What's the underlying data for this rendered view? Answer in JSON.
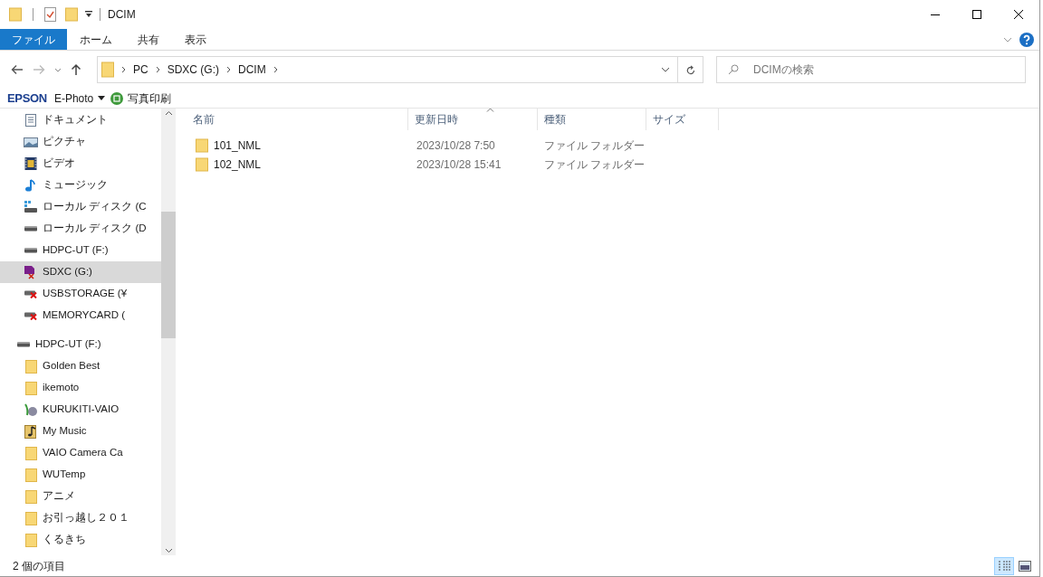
{
  "window": {
    "title": "DCIM"
  },
  "ribbon_tabs": [
    {
      "label": "ファイル",
      "selected": true
    },
    {
      "label": "ホーム",
      "selected": false
    },
    {
      "label": "共有",
      "selected": false
    },
    {
      "label": "表示",
      "selected": false
    }
  ],
  "address": {
    "path": [
      "PC",
      "SDXC (G:)",
      "DCIM"
    ]
  },
  "search": {
    "placeholder": "DCIMの検索"
  },
  "toolbar": {
    "brand": "EPSON",
    "app": "E-Photo",
    "print": "写真印刷"
  },
  "sidebar": {
    "pc_items": [
      {
        "label": "ドキュメント",
        "kind": "document",
        "selected": false
      },
      {
        "label": "ピクチャ",
        "kind": "picture",
        "selected": false
      },
      {
        "label": "ビデオ",
        "kind": "video",
        "selected": false
      },
      {
        "label": "ミュージック",
        "kind": "music",
        "selected": false
      },
      {
        "label": "ローカル ディスク (C",
        "kind": "osdrive",
        "selected": false
      },
      {
        "label": "ローカル ディスク (D",
        "kind": "drive",
        "selected": false
      },
      {
        "label": "HDPC-UT (F:)",
        "kind": "drive",
        "selected": false
      },
      {
        "label": "SDXC (G:)",
        "kind": "card",
        "selected": true
      },
      {
        "label": "USBSTORAGE (¥",
        "kind": "removable",
        "selected": false
      },
      {
        "label": "MEMORYCARD (",
        "kind": "removable",
        "selected": false
      }
    ],
    "tree": [
      {
        "label": "HDPC-UT (F:)",
        "kind": "drive",
        "selected": false,
        "children": [
          {
            "label": "Golden Best",
            "kind": "folder",
            "selected": false
          },
          {
            "label": "ikemoto",
            "kind": "folder",
            "selected": false
          },
          {
            "label": "KURUKITI-VAIO",
            "kind": "network",
            "selected": false
          },
          {
            "label": "My Music",
            "kind": "musicfolder",
            "selected": false
          },
          {
            "label": "VAIO Camera Ca",
            "kind": "folder",
            "selected": false
          },
          {
            "label": "WUTemp",
            "kind": "folder",
            "selected": false
          },
          {
            "label": "アニメ",
            "kind": "folder",
            "selected": false
          },
          {
            "label": "お引っ越し２０１",
            "kind": "folder",
            "selected": false
          },
          {
            "label": "くるきち",
            "kind": "folder",
            "selected": false
          }
        ]
      }
    ]
  },
  "table": {
    "columns": [
      "名前",
      "更新日時",
      "種類",
      "サイズ"
    ],
    "rows": [
      {
        "name": "101_NML",
        "modified": "2023/10/28 7:50",
        "type": "ファイル フォルダー"
      },
      {
        "name": "102_NML",
        "modified": "2023/10/28 15:41",
        "type": "ファイル フォルダー"
      }
    ]
  },
  "status_bar": {
    "count": "2 個の項目"
  }
}
